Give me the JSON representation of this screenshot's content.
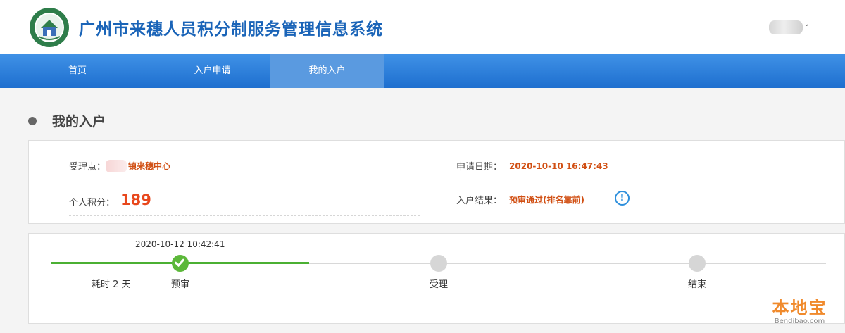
{
  "header": {
    "title": "广州市来穗人员积分制服务管理信息系统",
    "user_caret": "˅"
  },
  "nav": {
    "items": [
      {
        "label": "首页"
      },
      {
        "label": "入户申请"
      },
      {
        "label": "我的入户"
      }
    ],
    "active_index": 2
  },
  "page": {
    "heading": "我的入户"
  },
  "info": {
    "accept_point_label": "受理点：",
    "accept_point_value": "镇来穗中心",
    "apply_date_label": "申请日期：",
    "apply_date_value": "2020-10-10 16:47:43",
    "score_label": "个人积分：",
    "score_value": "189",
    "result_label": "入户结果：",
    "result_value": "预审通过(排名靠前)",
    "alert_icon_glyph": "!"
  },
  "progress": {
    "step1_time": "2020-10-12 10:42:41",
    "elapsed": "耗时 2 天",
    "steps": [
      {
        "label": "预审",
        "done": true
      },
      {
        "label": "受理",
        "done": false
      },
      {
        "label": "结束",
        "done": false
      }
    ]
  },
  "watermark": {
    "text": "本地宝",
    "sub": "Bendibao.com"
  },
  "colors": {
    "brand_blue": "#1a64b8",
    "nav_blue": "#2b7de0",
    "accent_red": "#d14f13",
    "progress_green": "#4bb033"
  }
}
